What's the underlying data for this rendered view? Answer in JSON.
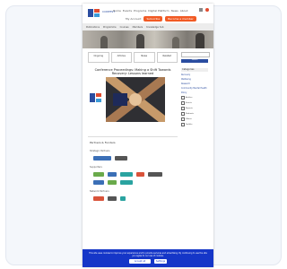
{
  "nav": {
    "brand": "CONTEST",
    "links": [
      "Home",
      "Events",
      "Programs",
      "Digital Platform",
      "News",
      "About"
    ],
    "login_label": "My Account",
    "cta_primary": "Subscribe",
    "cta_secondary": "Become a member"
  },
  "subnav": [
    "Publications",
    "Programme",
    "Courses",
    "Members",
    "Knowledge hub"
  ],
  "main": {
    "tabs": [
      "Ongoing",
      "Articles",
      "News",
      "Related"
    ],
    "article_title": "Conference Proceedings: Making a Shift Towards Recovery: Lessons learned"
  },
  "partners": {
    "heading": "Partners & Funders",
    "group1": "Strategic Partners",
    "group2": "Supporters",
    "group3": "Network Partners"
  },
  "sidebar": {
    "search_placeholder": "",
    "search_button": "Search",
    "filter_heading": "Categories",
    "items": [
      "Recovery",
      "Wellbeing",
      "Research",
      "Community Mental Health",
      "Policy"
    ],
    "checks": [
      "Articles",
      "Events",
      "Reports",
      "Podcasts",
      "Videos",
      "Toolkits"
    ]
  },
  "cookie": {
    "text": "This site uses cookies to improve your experience and to provide services and advertising. By continuing to use the site you agree to our use of cookies.",
    "accept": "Accept all",
    "settings": "Settings"
  },
  "colors": {
    "brand_blue": "#2b4da0",
    "brand_orange": "#f15a24",
    "cookie_bg": "#1536c8"
  }
}
